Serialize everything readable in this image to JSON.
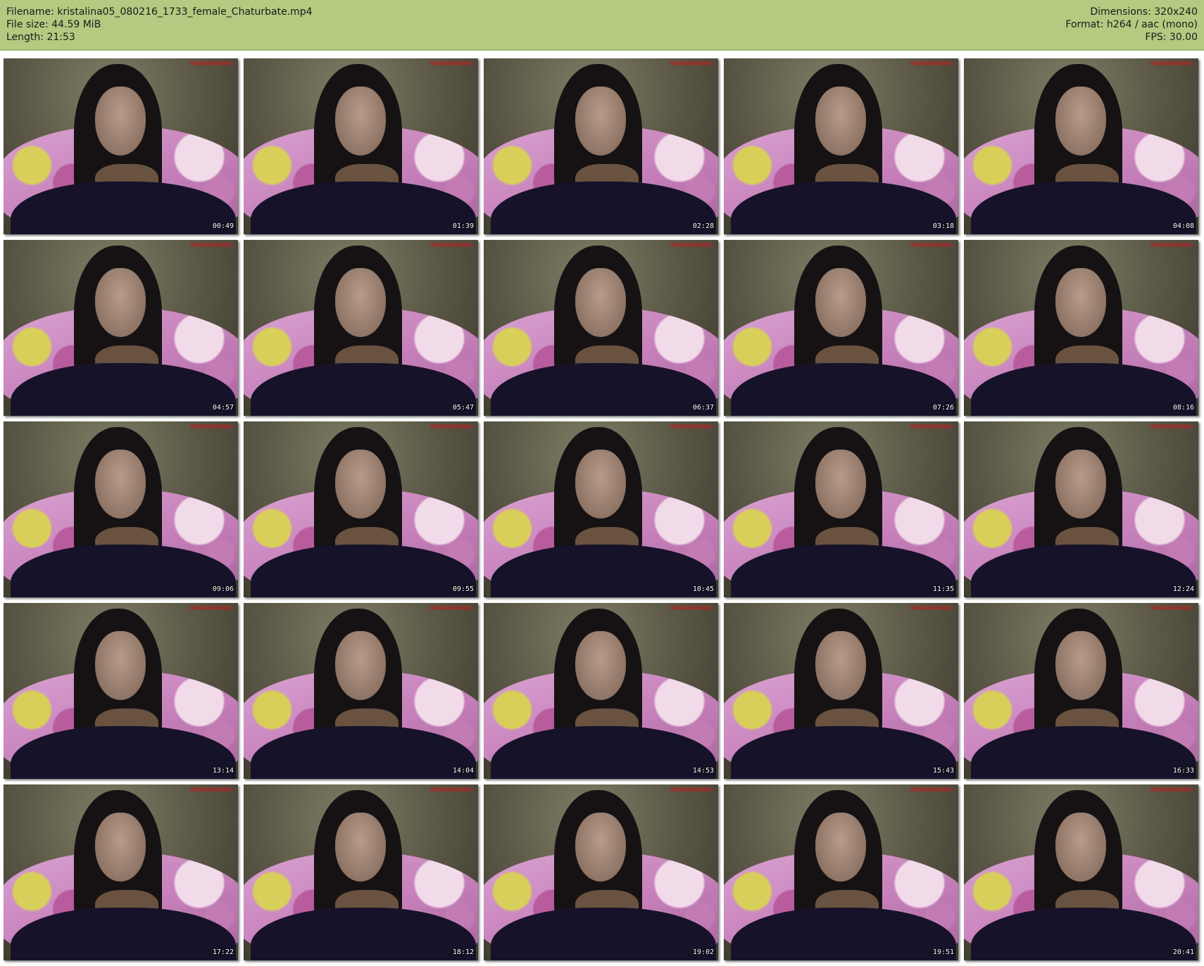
{
  "info": {
    "filename": "Filename: kristalina05_080216_1733_female_Chaturbate.mp4",
    "filesize": "File size: 44.59 MiB",
    "length": "Length: 21:53",
    "dimensions": "Dimensions: 320x240",
    "format": "Format: h264 / aac (mono)",
    "fps": "FPS: 30.00"
  },
  "colors": {
    "header_bg": "#b3ca80",
    "page_bg": "#ffffff"
  },
  "thumbnails": [
    {
      "timestamp": "00:49"
    },
    {
      "timestamp": "01:39"
    },
    {
      "timestamp": "02:28"
    },
    {
      "timestamp": "03:18"
    },
    {
      "timestamp": "04:08"
    },
    {
      "timestamp": "04:57"
    },
    {
      "timestamp": "05:47"
    },
    {
      "timestamp": "06:37"
    },
    {
      "timestamp": "07:26"
    },
    {
      "timestamp": "08:16"
    },
    {
      "timestamp": "09:06"
    },
    {
      "timestamp": "09:55"
    },
    {
      "timestamp": "10:45"
    },
    {
      "timestamp": "11:35"
    },
    {
      "timestamp": "12:24"
    },
    {
      "timestamp": "13:14"
    },
    {
      "timestamp": "14:04"
    },
    {
      "timestamp": "14:53"
    },
    {
      "timestamp": "15:43"
    },
    {
      "timestamp": "16:33"
    },
    {
      "timestamp": "17:22"
    },
    {
      "timestamp": "18:12"
    },
    {
      "timestamp": "19:02"
    },
    {
      "timestamp": "19:51"
    },
    {
      "timestamp": "20:41"
    }
  ]
}
